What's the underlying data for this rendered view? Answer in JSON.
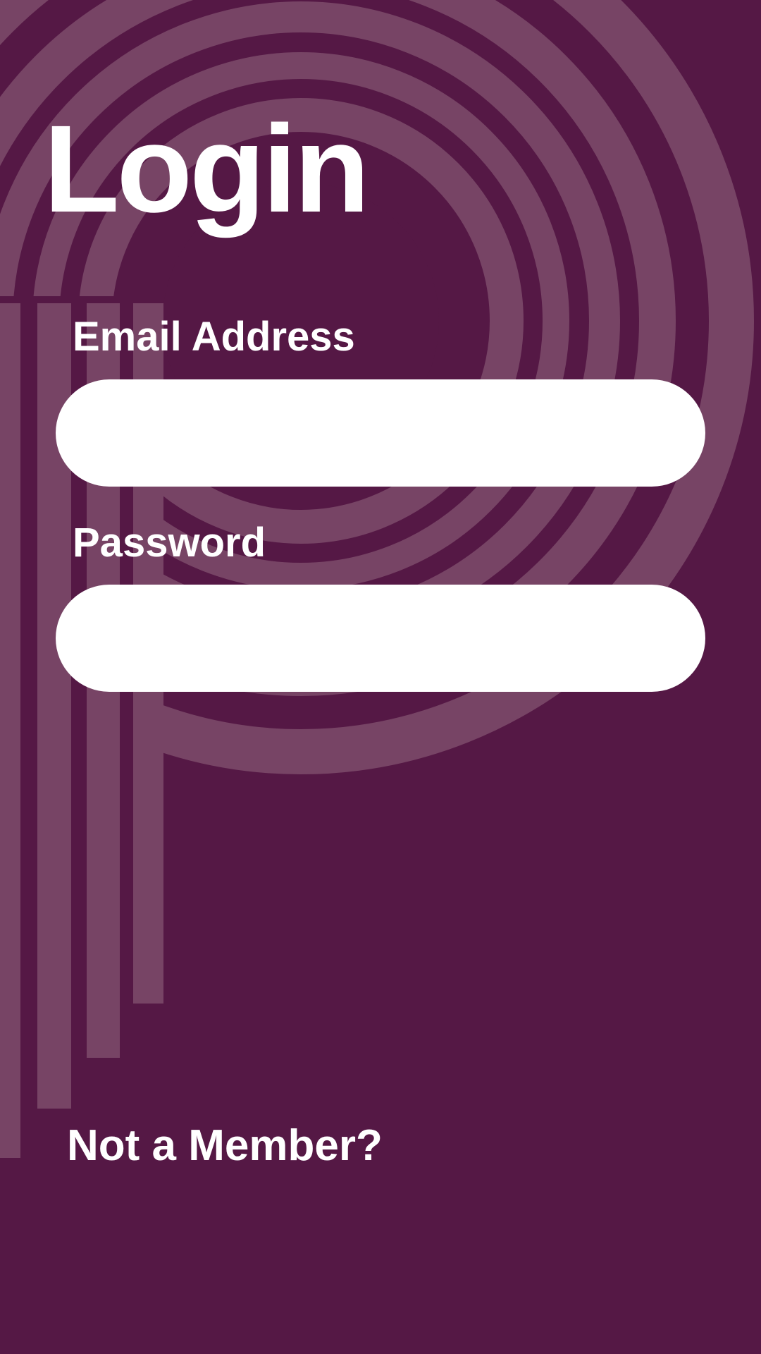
{
  "theme": {
    "background": "#551845",
    "decor_stripe": "#774465",
    "text": "#ffffff",
    "input_background": "#ffffff"
  },
  "login": {
    "title": "Login",
    "email_label": "Email Address",
    "email_value": "",
    "password_label": "Password",
    "password_value": "",
    "not_member_link": "Not a Member?"
  }
}
